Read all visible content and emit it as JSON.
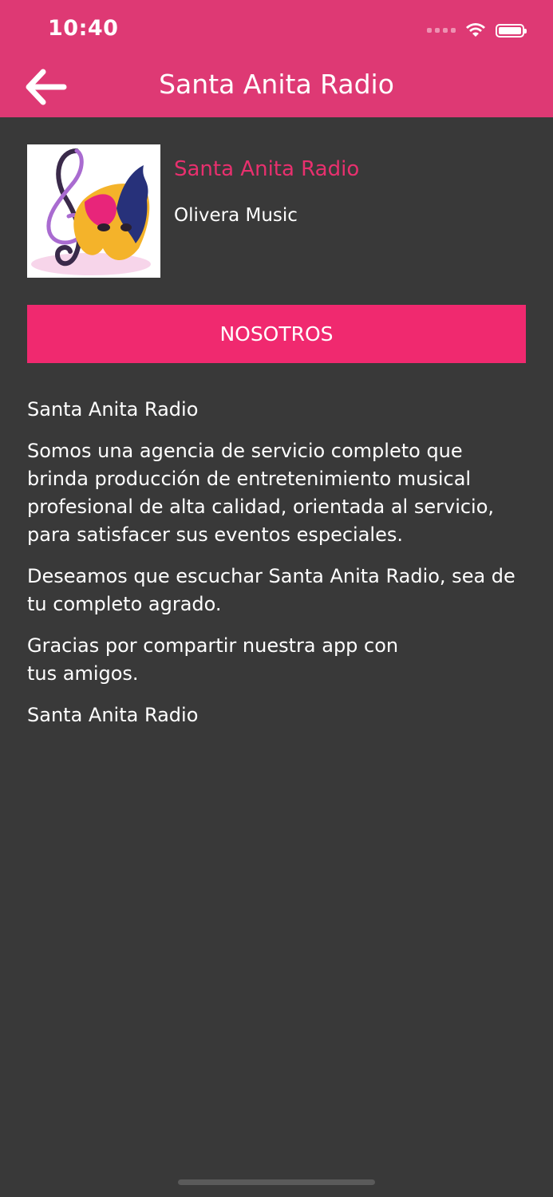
{
  "status_bar": {
    "time": "10:40"
  },
  "nav": {
    "title": "Santa Anita Radio",
    "back_icon": "arrow-left-icon"
  },
  "station": {
    "name": "Santa Anita Radio",
    "subtitle": "Olivera Music",
    "logo_icon": "treble-clef-mask-logo"
  },
  "button": {
    "label": "NOSOTROS"
  },
  "about": {
    "p1": "Santa Anita Radio",
    "p2": "Somos una agencia de servicio completo que brinda producción de entretenimiento musical profesional de alta calidad, orientada al servicio, para satisfacer sus eventos especiales.",
    "p3": "Deseamos que escuchar Santa Anita Radio, sea de tu completo agrado.",
    "p4": "Gracias por compartir nuestra app con tus amigos.",
    "p5": "Santa Anita Radio"
  },
  "colors": {
    "header": "#DE3974",
    "accent": "#F0296F",
    "background": "#393939"
  }
}
